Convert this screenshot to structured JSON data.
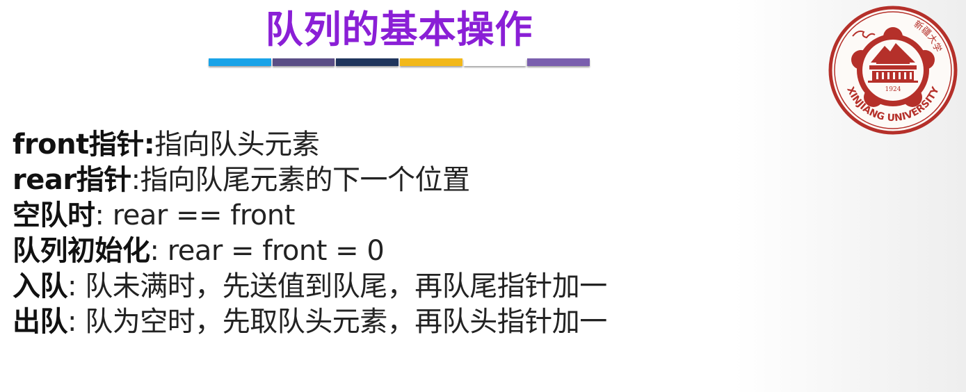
{
  "slide": {
    "title": "队列的基本操作",
    "title_color": "#8a1fd6",
    "underline_colors": [
      "#1aa3e8",
      "#5a4e86",
      "#1f355c",
      "#f2b81a",
      "#ffffff",
      "#7a5fae"
    ]
  },
  "logo": {
    "icon": "xinjiang-university-seal",
    "year": "1924",
    "name_en": "XINJIANG UNIVERSITY",
    "name_zh": "新疆大学",
    "color": "#b5302a"
  },
  "lines": [
    {
      "label": "front指针:",
      "text": "指向队头元素"
    },
    {
      "label": "rear指针",
      "text": ":指向队尾元素的下一个位置"
    },
    {
      "label": "空队时",
      "text": ": rear == front"
    },
    {
      "label": "队列初始化",
      "text": ": rear = front = 0"
    },
    {
      "label": "入队",
      "text": ": 队未满时，先送值到队尾，再队尾指针加一"
    },
    {
      "label": "出队",
      "text": ": 队为空时，先取队头元素，再队头指针加一"
    }
  ]
}
